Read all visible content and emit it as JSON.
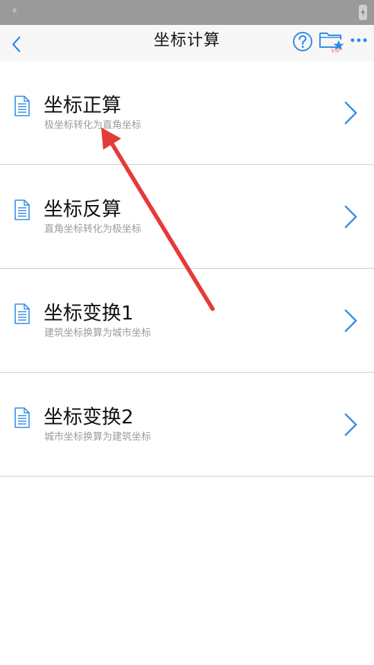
{
  "navbar": {
    "title": "坐标计算",
    "vip_label": "VIP",
    "icons": {
      "back": "chevron-left-icon",
      "help": "question-circle-icon",
      "favorite": "folder-star-icon",
      "more": "more-dots-icon"
    },
    "accent_color": "#2d8ae8"
  },
  "items": [
    {
      "title": "坐标正算",
      "subtitle": "极坐标转化为直角坐标"
    },
    {
      "title": "坐标反算",
      "subtitle": "直角坐标转化为极坐标"
    },
    {
      "title": "坐标变换1",
      "subtitle": "建筑坐标换算为城市坐标"
    },
    {
      "title": "坐标变换2",
      "subtitle": "城市坐标换算为建筑坐标"
    }
  ],
  "annotation": {
    "color": "#e53a3a"
  }
}
